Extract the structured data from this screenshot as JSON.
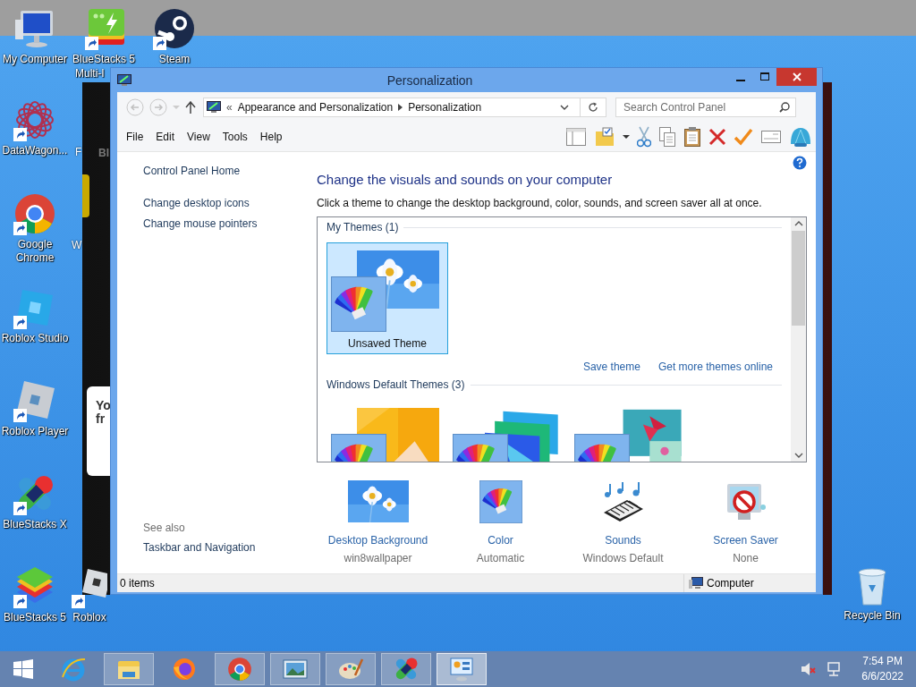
{
  "desktop": {
    "icons": [
      {
        "label": "My Computer",
        "kind": "computer",
        "shortcut": false
      },
      {
        "label": "BlueStacks 5",
        "second_line": "Multi-I",
        "kind": "bluestacks-multi",
        "shortcut": true
      },
      {
        "label": "Steam",
        "kind": "steam",
        "shortcut": true
      },
      {
        "label": "DataWagon...",
        "kind": "datawagon",
        "shortcut": true
      },
      {
        "label": "Google Chrome",
        "kind": "chrome",
        "shortcut": true
      },
      {
        "label": "Roblox Studio",
        "kind": "roblox-studio",
        "shortcut": true
      },
      {
        "label": "Roblox Player",
        "kind": "roblox-player",
        "shortcut": true
      },
      {
        "label": "BlueStacks X",
        "kind": "bluestacks-x",
        "shortcut": true
      },
      {
        "label": "BlueStacks 5",
        "kind": "bluestacks",
        "shortcut": true
      },
      {
        "label": "Roblox",
        "kind": "roblox",
        "shortcut": true
      },
      {
        "label": "Recycle Bin",
        "kind": "recycle-bin",
        "shortcut": false
      }
    ],
    "partial_labels": [
      "F",
      "W"
    ]
  },
  "background_window": {
    "brand_fragment": "BI",
    "card_lines": [
      "Yo",
      "fr"
    ]
  },
  "window": {
    "title": "Personalization",
    "address": {
      "overflow": "«",
      "crumbs": [
        "Appearance and Personalization",
        "Personalization"
      ]
    },
    "search": {
      "placeholder": "Search Control Panel"
    },
    "menu": [
      "File",
      "Edit",
      "View",
      "Tools",
      "Help"
    ],
    "sidebar": {
      "links": [
        "Control Panel Home",
        "Change desktop icons",
        "Change mouse pointers"
      ],
      "see_also_label": "See also",
      "see_also_links": [
        "Taskbar and Navigation"
      ]
    },
    "heading": "Change the visuals and sounds on your computer",
    "description": "Click a theme to change the desktop background, color, sounds, and screen saver all at once.",
    "theme_groups": [
      {
        "title": "My Themes (1)",
        "themes": [
          {
            "label": "Unsaved Theme",
            "selected": true
          }
        ],
        "links": [
          "Save theme",
          "Get more themes online"
        ]
      },
      {
        "title": "Windows Default Themes (3)",
        "themes": [
          {
            "selected": false
          },
          {
            "selected": false
          },
          {
            "selected": false
          }
        ]
      }
    ],
    "settings": [
      {
        "kind": "background",
        "title": "Desktop Background",
        "value": "win8wallpaper"
      },
      {
        "kind": "color",
        "title": "Color",
        "value": "Automatic"
      },
      {
        "kind": "sounds",
        "title": "Sounds",
        "value": "Windows Default"
      },
      {
        "kind": "screensaver",
        "title": "Screen Saver",
        "value": "None"
      }
    ],
    "status_bar": {
      "items": "0 items",
      "location": "Computer"
    }
  },
  "taskbar": {
    "apps": [
      {
        "kind": "ie",
        "running": false,
        "active": false
      },
      {
        "kind": "explorer",
        "running": true,
        "active": false
      },
      {
        "kind": "firefox",
        "running": false,
        "active": false
      },
      {
        "kind": "chrome",
        "running": true,
        "active": false
      },
      {
        "kind": "photos",
        "running": true,
        "active": false
      },
      {
        "kind": "paint",
        "running": true,
        "active": false
      },
      {
        "kind": "bluestacks-x",
        "running": true,
        "active": false
      },
      {
        "kind": "control-panel",
        "running": true,
        "active": true
      }
    ],
    "time": "7:54 PM",
    "date": "6/6/2022"
  }
}
